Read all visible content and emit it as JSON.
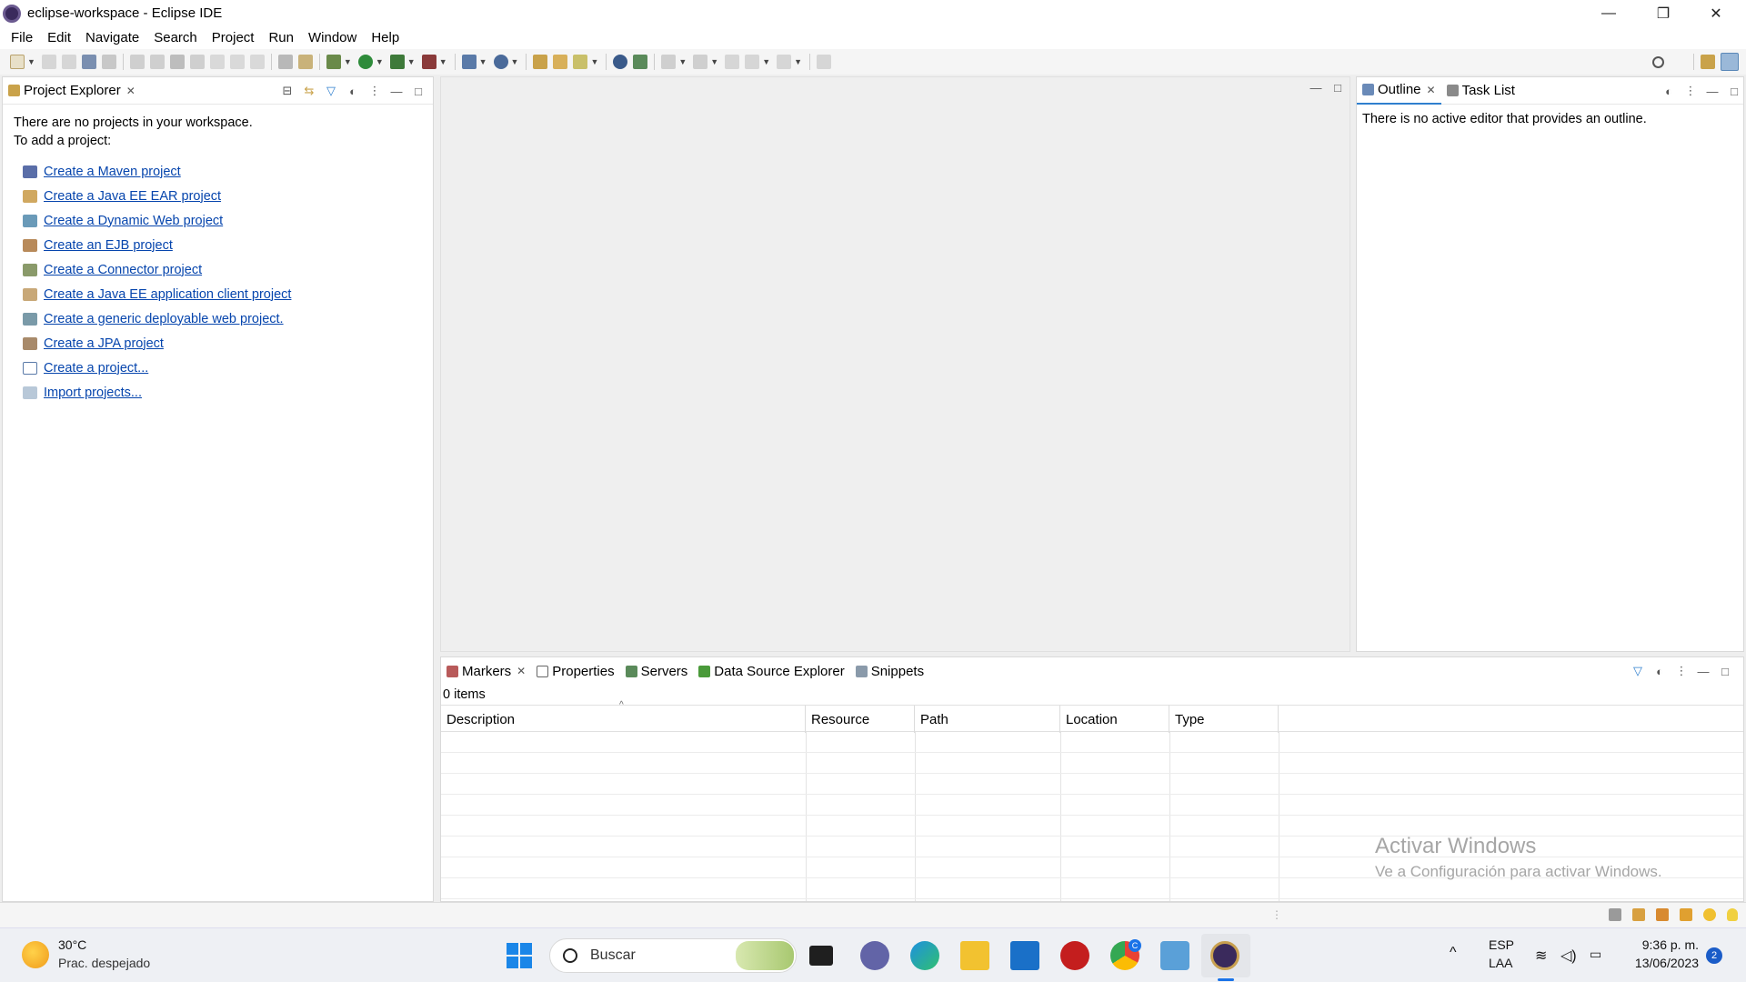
{
  "window": {
    "title": "eclipse-workspace - Eclipse IDE",
    "minimize": "—",
    "restore": "❐",
    "close": "✕"
  },
  "menu": [
    "File",
    "Edit",
    "Navigate",
    "Search",
    "Project",
    "Run",
    "Window",
    "Help"
  ],
  "project_explorer": {
    "tab_label": "Project Explorer",
    "message_line1": "There are no projects in your workspace.",
    "message_line2": "To add a project:",
    "links": [
      "Create a Maven project",
      "Create a Java EE EAR project",
      "Create a Dynamic Web project",
      "Create an EJB project",
      "Create a Connector project",
      "Create a Java EE application client project",
      "Create a generic deployable web project.",
      "Create a JPA project",
      "Create a project...",
      "Import projects..."
    ]
  },
  "outline": {
    "tab_label": "Outline",
    "second_tab_label": "Task List",
    "message": "There is no active editor that provides an outline."
  },
  "bottom_panel": {
    "tabs": [
      "Markers",
      "Properties",
      "Servers",
      "Data Source Explorer",
      "Snippets"
    ],
    "items_count": "0 items",
    "columns": [
      "Description",
      "Resource",
      "Path",
      "Location",
      "Type"
    ]
  },
  "watermark": {
    "line1": "Activar Windows",
    "line2": "Ve a Configuración para activar Windows."
  },
  "taskbar": {
    "weather_temp": "30°C",
    "weather_desc": "Prac. despejado",
    "search_label": "Buscar",
    "lang_line1": "ESP",
    "lang_line2": "LAA",
    "time": "9:36 p. m.",
    "date": "13/06/2023",
    "notification_count": "2",
    "chrome_badge": "C"
  },
  "colors": {
    "link": "#0645ad",
    "accent": "#2f7fce",
    "workarea_bg": "#eeeeee"
  }
}
